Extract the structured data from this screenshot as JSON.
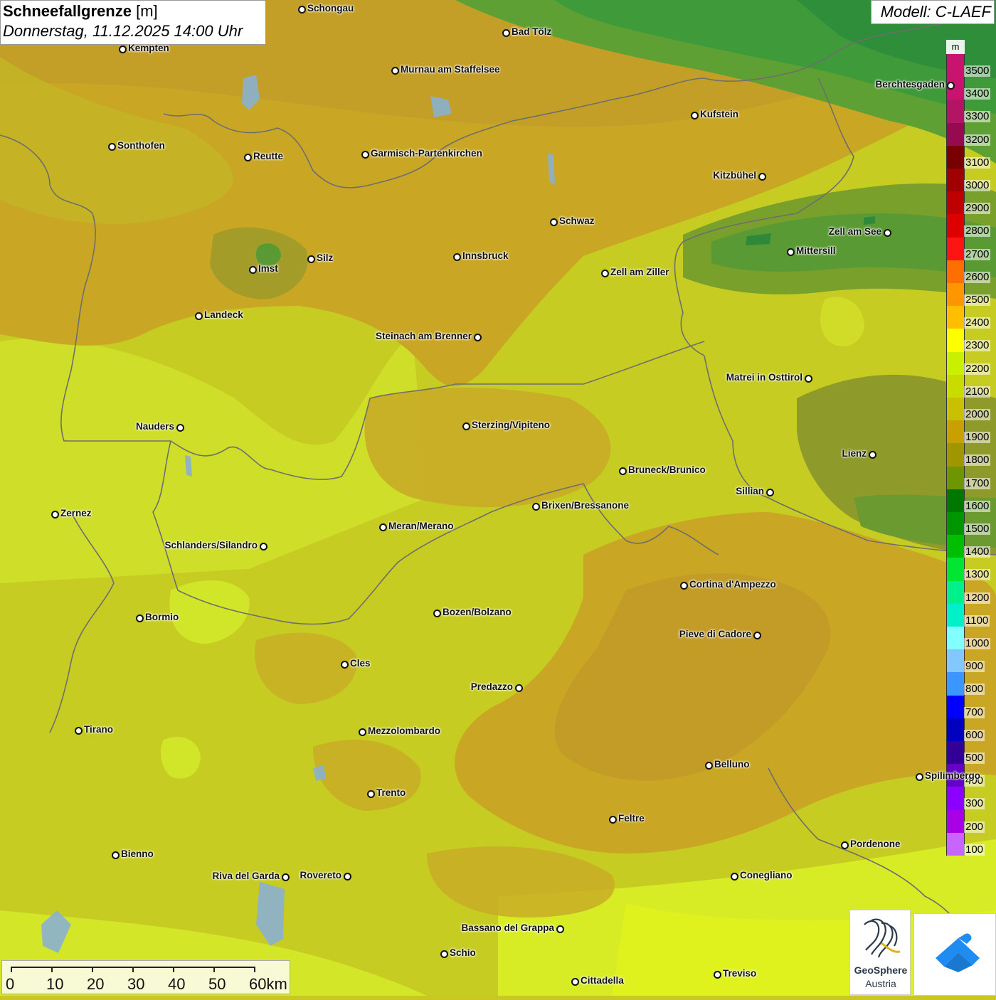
{
  "title": {
    "main": "Schneefallgrenze",
    "unit": "[m]",
    "datetime": "Donnerstag, 11.12.2025 14:00 Uhr"
  },
  "model": "Modell: C-LAEF",
  "legend": {
    "unit": "m",
    "entries": [
      {
        "label": "3500",
        "color": "#c8146e"
      },
      {
        "label": "3400",
        "color": "#c8146e"
      },
      {
        "label": "3300",
        "color": "#b41464"
      },
      {
        "label": "3200",
        "color": "#960a50"
      },
      {
        "label": "3100",
        "color": "#780000"
      },
      {
        "label": "3000",
        "color": "#a00000"
      },
      {
        "label": "2900",
        "color": "#be0000"
      },
      {
        "label": "2800",
        "color": "#dc0000"
      },
      {
        "label": "2700",
        "color": "#ff1414"
      },
      {
        "label": "2600",
        "color": "#ff6e00"
      },
      {
        "label": "2500",
        "color": "#ff9600"
      },
      {
        "label": "2400",
        "color": "#ffbe00"
      },
      {
        "label": "2300",
        "color": "#ffff00"
      },
      {
        "label": "2200",
        "color": "#c8f000"
      },
      {
        "label": "2100",
        "color": "#c8dc00"
      },
      {
        "label": "2000",
        "color": "#c8c000"
      },
      {
        "label": "1900",
        "color": "#c8a000"
      },
      {
        "label": "1800",
        "color": "#a09600"
      },
      {
        "label": "1700",
        "color": "#6e9600"
      },
      {
        "label": "1600",
        "color": "#007800"
      },
      {
        "label": "1500",
        "color": "#009600"
      },
      {
        "label": "1400",
        "color": "#00be00"
      },
      {
        "label": "1300",
        "color": "#00e632"
      },
      {
        "label": "1200",
        "color": "#00f08c"
      },
      {
        "label": "1100",
        "color": "#00f0c8"
      },
      {
        "label": "1000",
        "color": "#82ffff"
      },
      {
        "label": "900",
        "color": "#82c8ff"
      },
      {
        "label": "800",
        "color": "#3c96ff"
      },
      {
        "label": "700",
        "color": "#0000ff"
      },
      {
        "label": "600",
        "color": "#0000be"
      },
      {
        "label": "500",
        "color": "#320096"
      },
      {
        "label": "400",
        "color": "#6400c8"
      },
      {
        "label": "300",
        "color": "#8c00ff"
      },
      {
        "label": "200",
        "color": "#aa00e6"
      },
      {
        "label": "100",
        "color": "#c864ff"
      }
    ]
  },
  "towns": [
    {
      "name": "Schongau"
    },
    {
      "name": "Bad Tölz"
    },
    {
      "name": "Kempten"
    },
    {
      "name": "Murnau am Staffelsee"
    },
    {
      "name": "Berchtesgaden"
    },
    {
      "name": "Kufstein"
    },
    {
      "name": "Sonthofen"
    },
    {
      "name": "Reutte"
    },
    {
      "name": "Garmisch-Partenkirchen"
    },
    {
      "name": "Kitzbühel"
    },
    {
      "name": "Schwaz"
    },
    {
      "name": "Zell am See"
    },
    {
      "name": "Mittersill"
    },
    {
      "name": "Innsbruck"
    },
    {
      "name": "Imst"
    },
    {
      "name": "Silz"
    },
    {
      "name": "Zell am Ziller"
    },
    {
      "name": "Landeck"
    },
    {
      "name": "Steinach am Brenner"
    },
    {
      "name": "Matrei in Osttirol"
    },
    {
      "name": "Nauders"
    },
    {
      "name": "Sterzing/Vipiteno"
    },
    {
      "name": "Lienz"
    },
    {
      "name": "Bruneck/Brunico"
    },
    {
      "name": "Sillian"
    },
    {
      "name": "Brixen/Bressanone"
    },
    {
      "name": "Zernez"
    },
    {
      "name": "Meran/Merano"
    },
    {
      "name": "Schlanders/Silandro"
    },
    {
      "name": "Cortina d'Ampezzo"
    },
    {
      "name": "Bormio"
    },
    {
      "name": "Bozen/Bolzano"
    },
    {
      "name": "Pieve di Cadore"
    },
    {
      "name": "Cles"
    },
    {
      "name": "Predazzo"
    },
    {
      "name": "Tirano"
    },
    {
      "name": "Mezzolombardo"
    },
    {
      "name": "Belluno"
    },
    {
      "name": "Spilimbergo"
    },
    {
      "name": "Trento"
    },
    {
      "name": "Feltre"
    },
    {
      "name": "Pordenone"
    },
    {
      "name": "Bienno"
    },
    {
      "name": "Riva del Garda"
    },
    {
      "name": "Rovereto"
    },
    {
      "name": "Conegliano"
    },
    {
      "name": "Bassano del Grappa"
    },
    {
      "name": "Schio"
    },
    {
      "name": "Treviso"
    },
    {
      "name": "Cittadella"
    }
  ],
  "scale": {
    "labels": [
      "0",
      "10",
      "20",
      "30",
      "40",
      "50",
      "60km"
    ]
  },
  "logos": {
    "geosphere_line1": "GeoSphere",
    "geosphere_line2": "Austria"
  }
}
